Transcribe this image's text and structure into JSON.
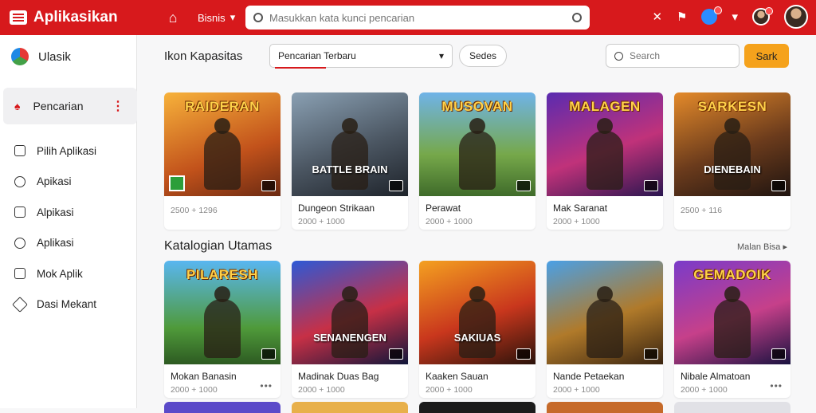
{
  "topbar": {
    "app_title": "Aplikasikan",
    "nav_dropdown": "Bisnis",
    "search_placeholder": "Masukkan kata kunci pencarian",
    "accent": "#d7191c"
  },
  "sidebar": {
    "brand": "Ulasik",
    "active_item": "Pencarian",
    "items": [
      {
        "label": "Pilih Aplikasi",
        "icon": "home-icon"
      },
      {
        "label": "Apikasi",
        "icon": "gear-icon"
      },
      {
        "label": "Alpikasi",
        "icon": "document-icon"
      },
      {
        "label": "Aplikasi",
        "icon": "compass-icon"
      },
      {
        "label": "Mok Aplik",
        "icon": "grid-icon"
      },
      {
        "label": "Dasi Mekant",
        "icon": "diamond-icon"
      }
    ]
  },
  "filterbar": {
    "page_title": "Ikon Kapasitas",
    "dropdown_value": "Pencarian Terbaru",
    "pill_label": "Sedes",
    "search_placeholder": "Search",
    "search_button": "Sark"
  },
  "row1": [
    {
      "thumb_title": "RAIDERAN",
      "title": "",
      "meta": "2500 + 1296",
      "bg": "linear-gradient(160deg,#f7b23b,#c2521b 60%,#6b2a12)",
      "dots": false
    },
    {
      "thumb_title": "",
      "sub": "BATTLE BRAIN",
      "title": "Dungeon Strikaan",
      "meta": "2000 + 1000",
      "bg": "linear-gradient(160deg,#8aa0b3,#4b5662 55%,#1e232a)",
      "dots": false
    },
    {
      "thumb_title": "MUSOVAN",
      "title": "Perawat",
      "meta": "2000 + 1000",
      "bg": "linear-gradient(180deg,#6fb3e8,#76a84a 60%,#3f6b2a)",
      "dots": false
    },
    {
      "thumb_title": "MALAGEN",
      "title": "Mak Saranat",
      "meta": "2000 + 1000",
      "bg": "linear-gradient(160deg,#5a2bb0,#c0327a 55%,#2a1650)",
      "dots": false
    },
    {
      "thumb_title": "SARKESN",
      "sub": "DIENEBAIN",
      "title": "",
      "meta": "2500 + 116",
      "bg": "linear-gradient(160deg,#e48a2a,#6b3b1c 55%,#1f1410)",
      "dots": false
    }
  ],
  "section": {
    "title": "Katalogian Utamas",
    "link": "Malan Bisa"
  },
  "row2": [
    {
      "thumb_title": "PILARESH",
      "title": "Mokan Banasin",
      "meta": "2000 + 1000",
      "bg": "linear-gradient(180deg,#59b6f0,#4f9a3a 65%,#2d5a22)",
      "dots": true
    },
    {
      "thumb_title": "",
      "sub": "SENANENGEN",
      "title": "Madinak Duas Bag",
      "meta": "2000 + 1000",
      "bg": "linear-gradient(160deg,#2d59d6,#c73046 55%,#10163a)",
      "dots": false
    },
    {
      "thumb_title": "",
      "sub": "SAKIUAS",
      "title": "Kaaken Sauan",
      "meta": "2000 + 1000",
      "bg": "linear-gradient(160deg,#f4a020,#c9371d 55%,#2a120a)",
      "dots": false
    },
    {
      "thumb_title": "",
      "title": "Nande Petaekan",
      "meta": "2000 + 1000",
      "bg": "linear-gradient(160deg,#4aa0e6,#b07a2a 55%,#3a2410)",
      "dots": false
    },
    {
      "thumb_title": "GEMADOIK",
      "title": "Nibale Almatoan",
      "meta": "2000 + 1000",
      "bg": "linear-gradient(160deg,#7a3bc9,#c6408a 55%,#1a1240)",
      "dots": true
    }
  ],
  "peek_colors": [
    "#5b4ac9",
    "#e8b04a",
    "#1c1c1c",
    "#c66a2a",
    "#e1e1e6"
  ]
}
